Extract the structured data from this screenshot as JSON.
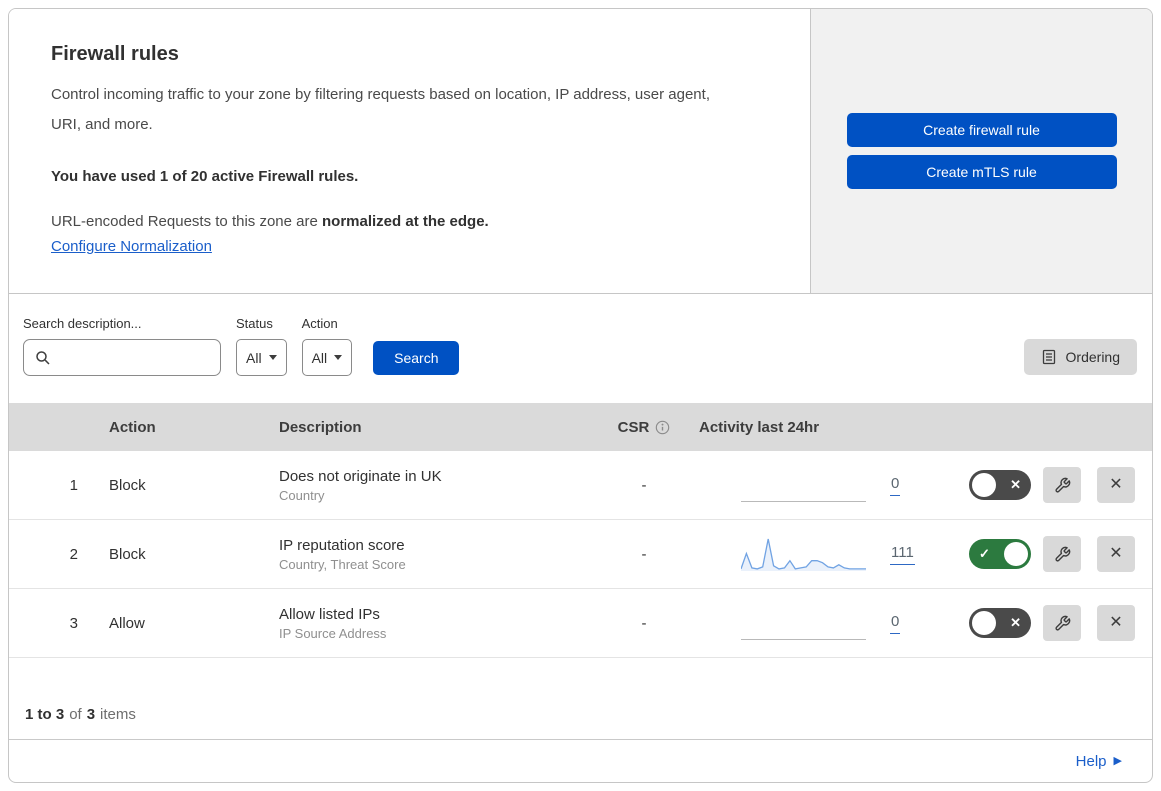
{
  "header": {
    "title": "Firewall rules",
    "description": "Control incoming traffic to your zone by filtering requests based on location, IP address, user agent, URI, and more.",
    "usage_note": "You have used 1 of 20 active Firewall rules.",
    "normalization_prefix": "URL-encoded Requests to this zone are",
    "normalization_bold": "normalized at the edge.",
    "normalization_link": "Configure Normalization",
    "create_firewall_button": "Create firewall rule",
    "create_mtls_button": "Create mTLS rule"
  },
  "filters": {
    "search_label": "Search description...",
    "search_value": "",
    "status_label": "Status",
    "status_value": "All",
    "action_label": "Action",
    "action_value": "All",
    "search_button": "Search",
    "ordering_button": "Ordering"
  },
  "table": {
    "headers": {
      "action": "Action",
      "description": "Description",
      "csr": "CSR",
      "activity": "Activity last 24hr"
    },
    "rows": [
      {
        "num": "1",
        "action": "Block",
        "title": "Does not originate in UK",
        "subtitle": "Country",
        "csr": "-",
        "count": "0",
        "enabled": false
      },
      {
        "num": "2",
        "action": "Block",
        "title": "IP reputation score",
        "subtitle": "Country, Threat Score",
        "csr": "-",
        "count": "111",
        "enabled": true,
        "sparkline_values": [
          2,
          17,
          3,
          2,
          4,
          31,
          5,
          2,
          3,
          10,
          2,
          3,
          4,
          10,
          10,
          8,
          4,
          3,
          6,
          3,
          2,
          2,
          2,
          2
        ]
      },
      {
        "num": "3",
        "action": "Allow",
        "title": "Allow listed IPs",
        "subtitle": "IP Source Address",
        "csr": "-",
        "count": "0",
        "enabled": false
      }
    ]
  },
  "footer": {
    "range": "1 to 3",
    "of_word": "of",
    "total": "3",
    "items_word": "items",
    "help_label": "Help"
  },
  "icons": {
    "check_glyph": "✓",
    "x_glyph": "✕",
    "close_glyph": "✕",
    "help_arrow_glyph": "▶"
  },
  "colors": {
    "primary_button_blue": "#0051c3",
    "link_blue": "#1a5eca",
    "toggle_on_green": "#2c7a3f",
    "toggle_off_gray": "#4a4a4a",
    "sparkline_blue": "#71a3e3",
    "sparkline_fill": "rgba(113,163,227,0.15)",
    "table_header_gray": "#dadada",
    "panel_gray": "#f1f1f1",
    "control_button_gray": "#d9d9d9"
  }
}
